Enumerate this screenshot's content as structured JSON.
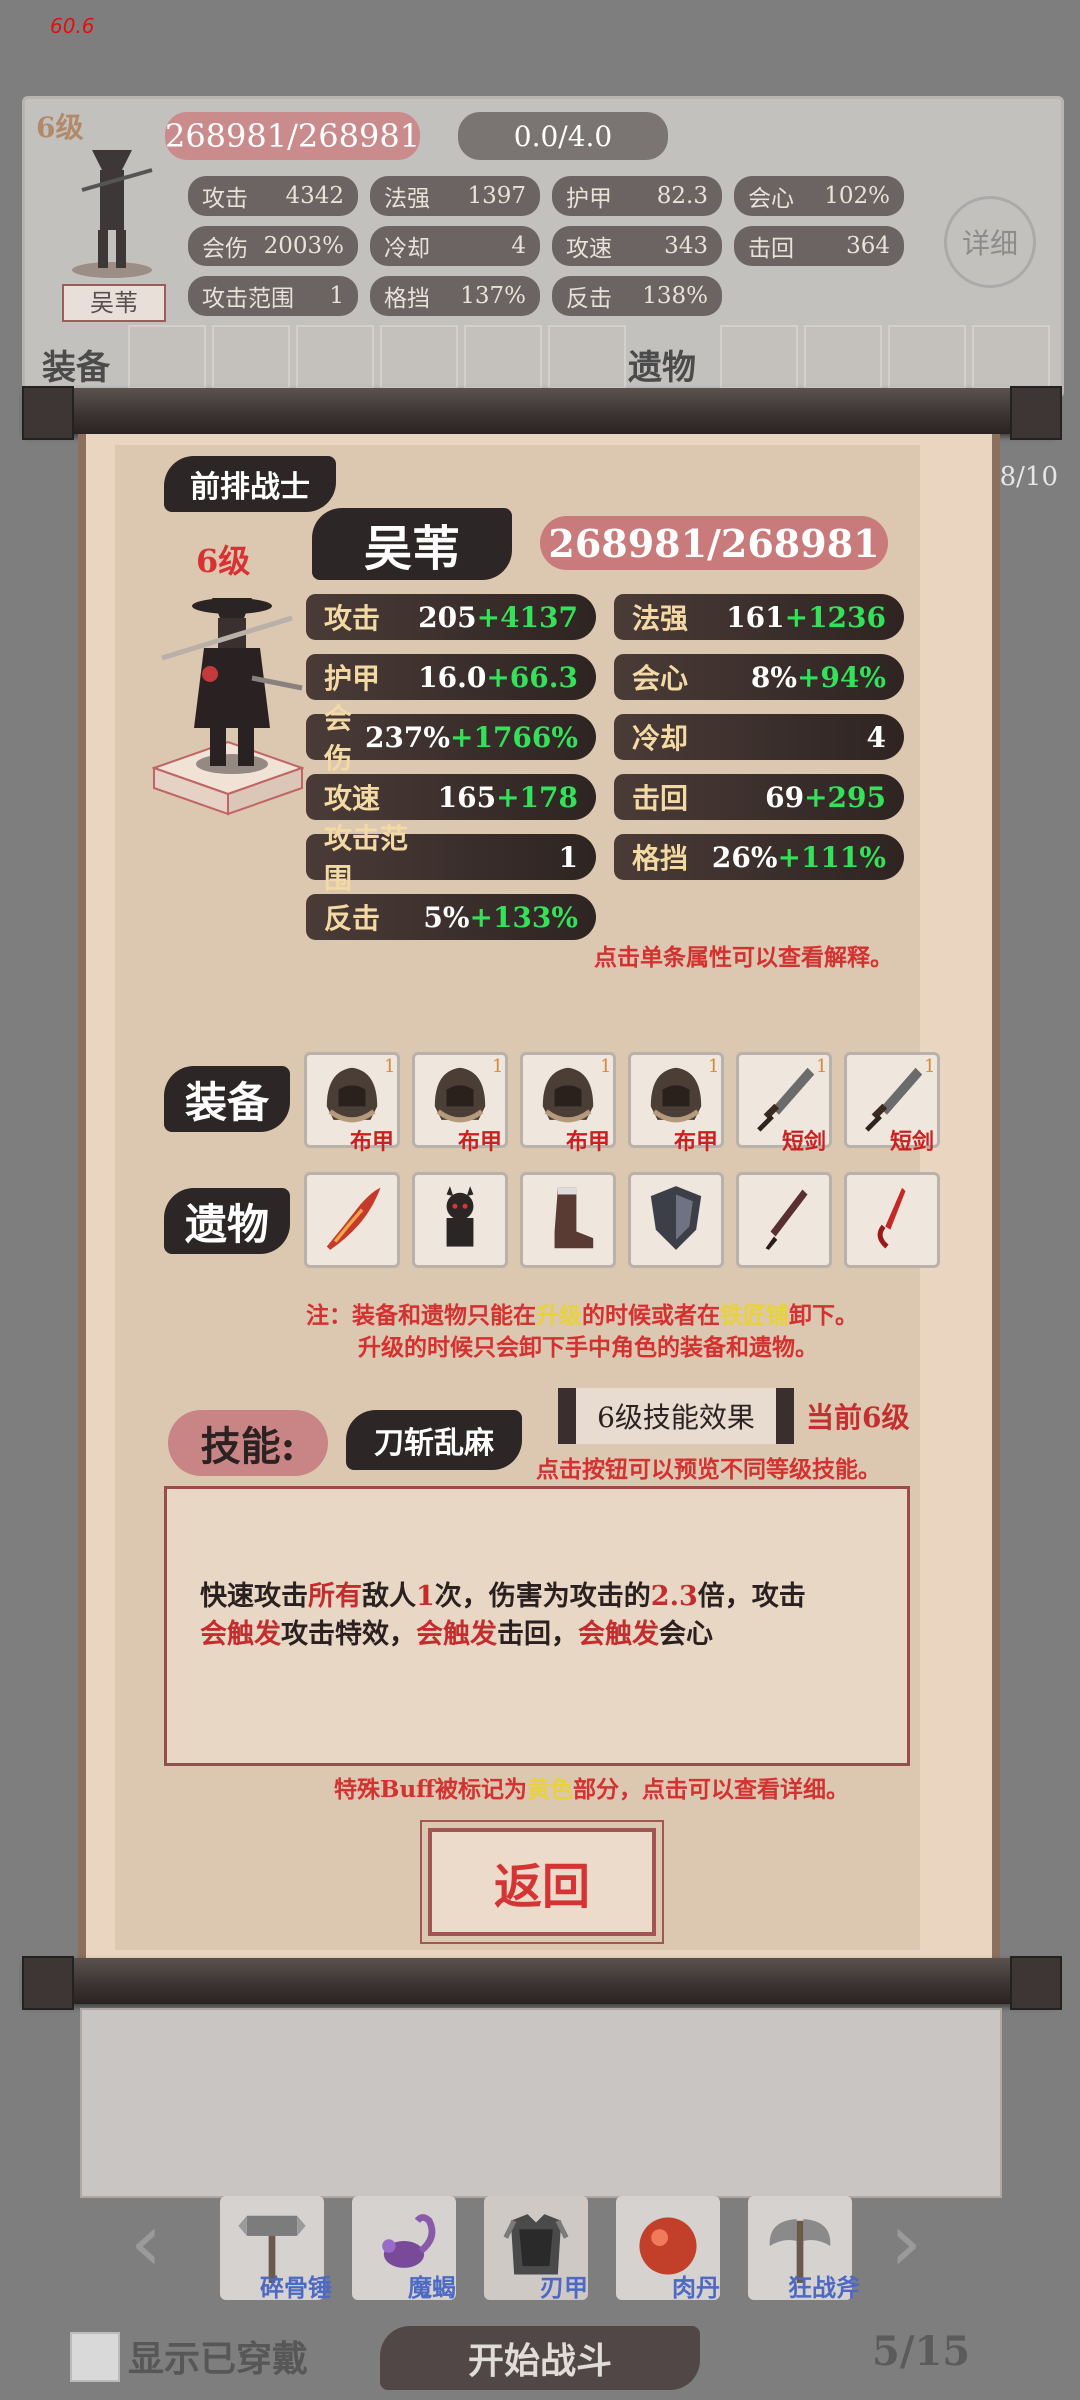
{
  "fps": "60.6",
  "bg_panel": {
    "level": "6级",
    "name": "吴苇",
    "hp": "268981/268981",
    "shield": "0.0/4.0",
    "stats": [
      {
        "name": "攻击",
        "value": "4342"
      },
      {
        "name": "法强",
        "value": "1397"
      },
      {
        "name": "护甲",
        "value": "82.3"
      },
      {
        "name": "会心",
        "value": "102%"
      },
      {
        "name": "会伤",
        "value": "2003%"
      },
      {
        "name": "冷却",
        "value": "4"
      },
      {
        "name": "攻速",
        "value": "343"
      },
      {
        "name": "击回",
        "value": "364"
      },
      {
        "name": "攻击范围",
        "value": "1"
      },
      {
        "name": "格挡",
        "value": "137%"
      },
      {
        "name": "反击",
        "value": "138%"
      }
    ],
    "detail_btn": "详细",
    "equip_label": "装备",
    "relic_label": "遗物"
  },
  "page_count": "8/10",
  "detail": {
    "role": "前排战士",
    "level": "6级",
    "name": "吴苇",
    "hp": "268981/268981",
    "stats": [
      {
        "name": "攻击",
        "base": "205",
        "bonus": "+4137"
      },
      {
        "name": "法强",
        "base": "161",
        "bonus": "+1236"
      },
      {
        "name": "护甲",
        "base": "16.0",
        "bonus": "+66.3"
      },
      {
        "name": "会心",
        "base": "8%",
        "bonus": "+94%"
      },
      {
        "name": "会伤",
        "base": "237%",
        "bonus": "+1766%"
      },
      {
        "name": "冷却",
        "base": "4",
        "bonus": ""
      },
      {
        "name": "攻速",
        "base": "165",
        "bonus": "+178"
      },
      {
        "name": "击回",
        "base": "69",
        "bonus": "+295"
      },
      {
        "name": "攻击范围",
        "base": "1",
        "bonus": ""
      },
      {
        "name": "格挡",
        "base": "26%",
        "bonus": "+111%"
      },
      {
        "name": "反击",
        "base": "5%",
        "bonus": "+133%"
      }
    ],
    "stat_hint": "点击单条属性可以查看解释。",
    "equip_label": "装备",
    "relic_label": "遗物",
    "equipment": [
      {
        "name": "布甲",
        "level": "1",
        "icon": "helmet-icon"
      },
      {
        "name": "布甲",
        "level": "1",
        "icon": "helmet-icon"
      },
      {
        "name": "布甲",
        "level": "1",
        "icon": "helmet-icon"
      },
      {
        "name": "布甲",
        "level": "1",
        "icon": "helmet-icon"
      },
      {
        "name": "短剑",
        "level": "1",
        "icon": "dagger-icon"
      },
      {
        "name": "短剑",
        "level": "1",
        "icon": "dagger-icon"
      }
    ],
    "relics": [
      {
        "icon": "flame-blade-icon"
      },
      {
        "icon": "demon-figure-icon"
      },
      {
        "icon": "boot-icon"
      },
      {
        "icon": "shield-icon"
      },
      {
        "icon": "knife-icon"
      },
      {
        "icon": "red-dagger-icon"
      }
    ],
    "note_prefix": "注：装备和遗物只能在",
    "note_upgrade": "升级",
    "note_mid": "的时候或者在",
    "note_smith": "铁匠铺",
    "note_suffix": "卸下。",
    "note_line2": "升级的时候只会卸下手中角色的装备和遗物。",
    "skill_label": "技能:",
    "skill_name": "刀斩乱麻",
    "skill_level_btn": "6级技能效果",
    "skill_current": "当前6级",
    "skill_hint": "点击按钮可以预览不同等级技能。",
    "skill_desc": {
      "p1": "快速攻击",
      "p2": "所有",
      "p3": "敌人",
      "p4": "1",
      "p5": "次，伤害为攻击的",
      "p6": "2.3",
      "p7": "倍，攻击",
      "p8": "会触发",
      "p9": "攻击特效，",
      "p10": "会触发",
      "p11": "击回，",
      "p12": "会触发",
      "p13": "会心"
    },
    "buff_note_a": "特殊Buff被标记为",
    "buff_note_b": "黄色",
    "buff_note_c": "部分，点击可以查看详细。",
    "back_btn": "返回"
  },
  "bottom": {
    "heroes": [
      {
        "name": "碎骨锤",
        "icon": "hammer-icon"
      },
      {
        "name": "魔蝎",
        "icon": "scorpion-icon"
      },
      {
        "name": "刃甲",
        "icon": "armor-icon"
      },
      {
        "name": "肉丹",
        "icon": "orb-icon"
      },
      {
        "name": "狂战斧",
        "icon": "axe-icon"
      }
    ],
    "show_equipped": "显示已穿戴",
    "start_battle": "开始战斗",
    "page": "5/15"
  }
}
